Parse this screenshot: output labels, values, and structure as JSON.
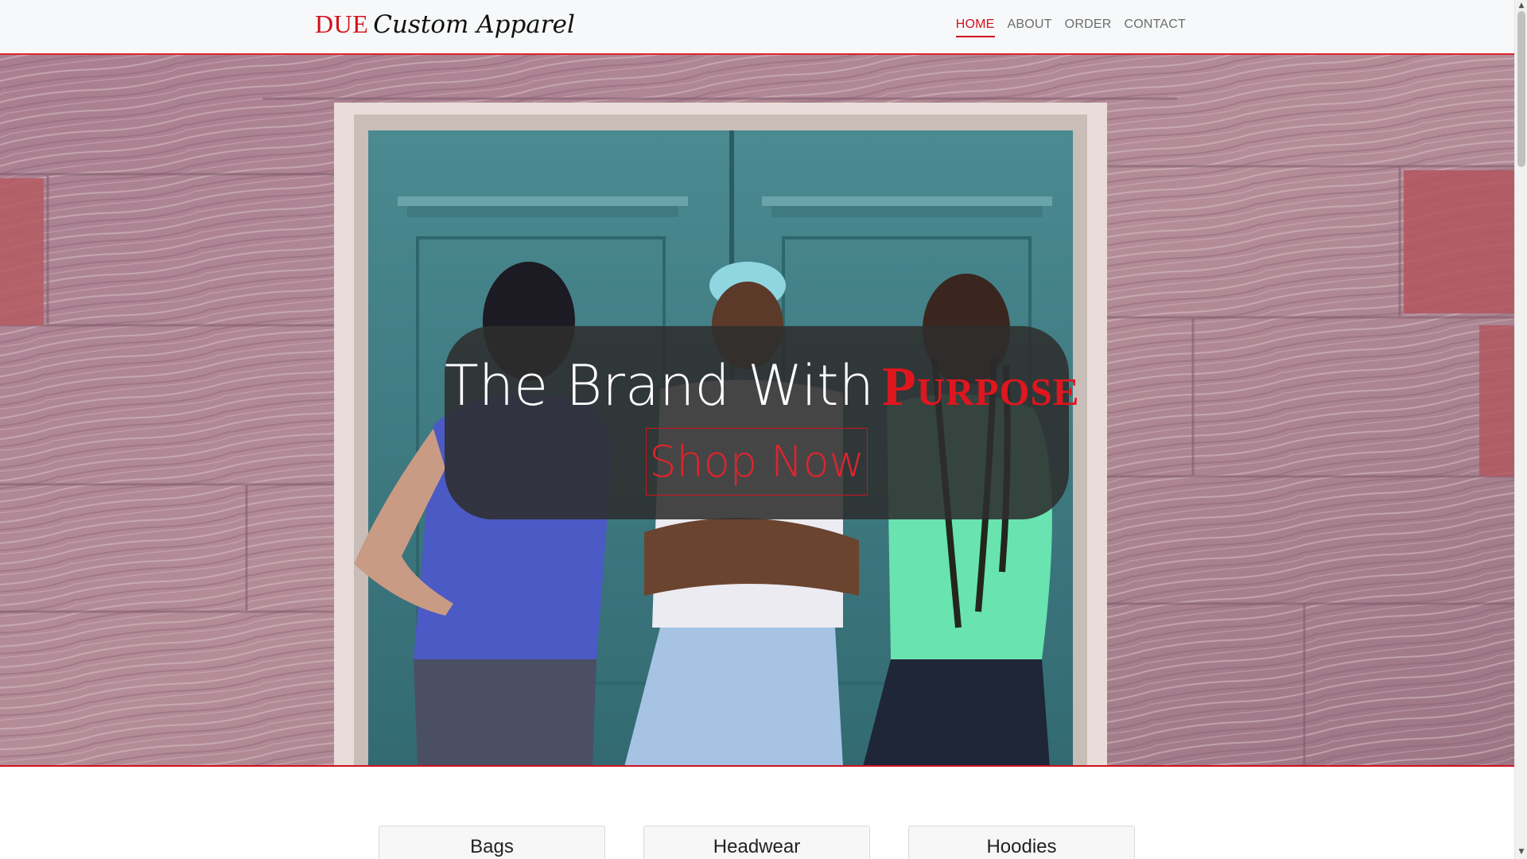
{
  "nav": {
    "brand_accent": "DUE",
    "brand_text": "Custom Apparel",
    "links": [
      {
        "label": "HOME",
        "active": true
      },
      {
        "label": "ABOUT",
        "active": false
      },
      {
        "label": "ORDER",
        "active": false
      },
      {
        "label": "CONTACT",
        "active": false
      }
    ]
  },
  "hero": {
    "headline": "The Brand With",
    "headline_accent": "Purpose",
    "cta_label": "Shop Now"
  },
  "categories": [
    {
      "label": "Bags"
    },
    {
      "label": "Headwear"
    },
    {
      "label": "Hoodies"
    }
  ],
  "colors": {
    "accent": "#d1121c",
    "navbar_bg": "#f7f8f9",
    "overlay_bg": "#2d2d2d"
  },
  "icons": {
    "scroll_up": "triangle-up",
    "scroll_down": "triangle-down"
  }
}
